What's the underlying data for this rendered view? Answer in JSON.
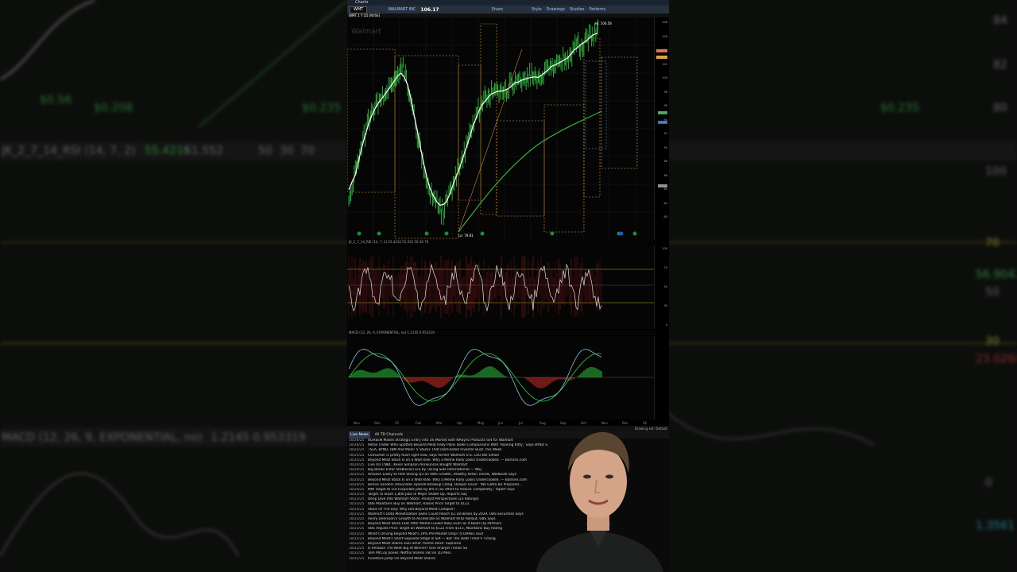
{
  "background": {
    "left_texts": [
      "$0.56",
      "$0.208",
      "$0.235",
      "JK_2_7_14_RSI (14, 7, 2)",
      "55.4216",
      "51.552",
      "50",
      "30",
      "70"
    ],
    "right_texts": [
      "84",
      "82",
      "80",
      "$0.235",
      "100",
      "70",
      "56.9042",
      "50",
      "30",
      "23.0268",
      "1.3561",
      "0"
    ],
    "bottom_left": [
      "MACD (12, 26, 9, EXPONENTIAL, no)",
      "1.2145",
      "0.953319"
    ]
  },
  "app": {
    "title": "Charts",
    "toolbar": {
      "symbol": "WMT",
      "company": "WALMART INC",
      "price": "106.17",
      "items": [
        "Share",
        "Style",
        "Drawings",
        "Studies",
        "Patterns"
      ]
    },
    "chart_header": "WMT 1 Y 1D [NYSE]",
    "watermark": "Walmart",
    "hi_label": "Hi: 106.58",
    "lo_label": "Lo: 79.81",
    "price_axis": [
      "108",
      "106",
      "104",
      "102",
      "100",
      "98",
      "96",
      "94",
      "92",
      "90",
      "88",
      "86",
      "84",
      "82",
      "80"
    ],
    "price_tags": [
      {
        "value": "106.17",
        "color": "#e8643c"
      },
      {
        "value": "104.62",
        "color": "#e8a23c"
      },
      {
        "value": "99.25",
        "color": "#2fa84f"
      },
      {
        "value": "97.80",
        "color": "#3c5bd8"
      },
      {
        "value": "86.40",
        "color": "#888888"
      }
    ],
    "rsi_header": "JK_2_7_14_RSI (14, 7, 2)  55.4216  51.552  50  30  70",
    "rsi_axis": [
      "100",
      "70",
      "50",
      "30",
      "0"
    ],
    "macd_header": "MACD (12, 26, 9, EXPONENTIAL, no)  1.2145  0.953319",
    "x_axis": [
      "Nov",
      "Dec",
      "25",
      "Feb",
      "Mar",
      "Apr",
      "May",
      "Jun",
      "Jul",
      "Aug",
      "Sep",
      "Oct",
      "Nov",
      "Dec",
      "26"
    ],
    "drawing_set": "Drawing set: Default",
    "news_tabs": [
      "Live News",
      "All TD Channels"
    ],
    "news": [
      {
        "date": "10/26/25",
        "headline": "UGREEN Makes Strategic Entry into US Market with NASync Products Set for Walmart"
      },
      {
        "date": "10/26/25",
        "headline": "Retail Trader Who Spotted Beyond Meat Rally Plans Down Comparisons With 'Roaring Kitty,' Says BYND S"
      },
      {
        "date": "10/25/25",
        "headline": "TSLA, BYND, IBM And More: 5 Stocks That Dominated Investor Buzz This Week"
      },
      {
        "date": "10/25/25",
        "headline": "Consumer is pretty flush right now, says former Walmart U.S. CEO Bill Simon"
      },
      {
        "date": "10/25/25",
        "headline": "Beyond Meat Stock Is on a Wild Ride. Why a Meme Rally Looks Undercooked. — Barrons.com"
      },
      {
        "date": "10/24/25",
        "headline": "Live On CNBC, Kevin Simpson Announces Bought Walmart"
      },
      {
        "date": "10/24/25",
        "headline": "Big Banks Enter Stablecoin Era by Taking Side International — WSJ"
      },
      {
        "date": "10/24/25",
        "headline": "Amazon Likely to Post Strong Q3 on AWS Growth, Healthy Retail Trends, Wedbush Says"
      },
      {
        "date": "10/24/25",
        "headline": "Beyond Meat Stock Is on a Wild Ride. Why a Meme Rally Looks Undercooked. — Barrons.com"
      },
      {
        "date": "10/24/25",
        "headline": "Bernie Sanders Advocates OpenAI Breakup Citing 'Deeper Issue': 'We Gotta Be Prepared..."
      },
      {
        "date": "10/24/25",
        "headline": "MW Target to cut corporate jobs by 8% in an effort to reduce 'complexity,' report says"
      },
      {
        "date": "10/23/25",
        "headline": "Target To Slash 1,800 Jobs In Major Shake-Up, Reports Say"
      },
      {
        "date": "10/23/25",
        "headline": "Deep Dive Into Walmart Stock: Analyst Perspectives (23 Ratings)"
      },
      {
        "date": "10/23/25",
        "headline": "UBS Maintains Buy on Walmart, Raises Price Target to $122"
      },
      {
        "date": "10/23/25",
        "headline": "Stock Of The Day: Why Did Beyond Meat Collapse?"
      },
      {
        "date": "10/23/25",
        "headline": "Walmart's Data Monetization Sales Could Reach $2.18 Billion by 2029, UBS Securities Says"
      },
      {
        "date": "10/23/25",
        "headline": "Avery Dennison's Growth to Accelerate on Walmart RFID Rollout, UBS Says"
      },
      {
        "date": "10/23/25",
        "headline": "Beyond Meat Stock Falls After Meme-Fueled Rally Even as it Beefs Up Partners"
      },
      {
        "date": "10/23/25",
        "headline": "UBS Adjusts Price Target on Walmart to $122 From $115, Maintains Buy Rating"
      },
      {
        "date": "10/23/25",
        "headline": "What's Driving Beyond Meat's 19% Pre-Market Drop? (CORRECTED)"
      },
      {
        "date": "10/22/25",
        "headline": "Beyond Meat's Short-Squeeze Stage Is Set — But The Debt Timer's Ticking"
      },
      {
        "date": "10/22/25",
        "headline": "Beyond Meat shares soar amid 'meme stock' euphoria"
      },
      {
        "date": "10/22/25",
        "headline": "Is Amazon The Next Big AI Winner? One Analyst Thinks So"
      },
      {
        "date": "10/22/25",
        "headline": "Tom McCoy Jiones: Netflix Shares Fall on Q3 Miss"
      },
      {
        "date": "10/22/25",
        "headline": "Investors Jump On Beyond Meat Shares"
      }
    ]
  },
  "colors": {
    "price_line": "#2ecc40",
    "ma_white": "#ffffff",
    "ma_green": "#35b03a",
    "rsi": "#e0e0e0",
    "bars_up": "#2ecc40",
    "bars_down": "#d93025",
    "dash_orange": "#e09a2b",
    "dash_blue": "#5fa8ff"
  }
}
